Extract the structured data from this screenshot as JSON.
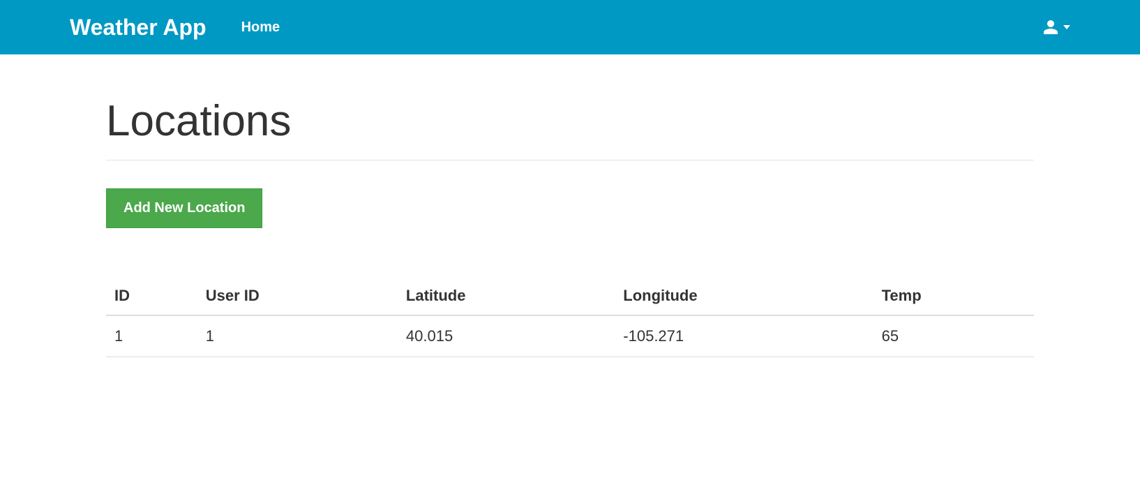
{
  "navbar": {
    "brand": "Weather App",
    "home_link": "Home"
  },
  "page": {
    "title": "Locations",
    "add_button": "Add New Location"
  },
  "table": {
    "headers": {
      "id": "ID",
      "user_id": "User ID",
      "latitude": "Latitude",
      "longitude": "Longitude",
      "temp": "Temp"
    },
    "rows": [
      {
        "id": "1",
        "user_id": "1",
        "latitude": "40.015",
        "longitude": "-105.271",
        "temp": "65"
      }
    ]
  }
}
